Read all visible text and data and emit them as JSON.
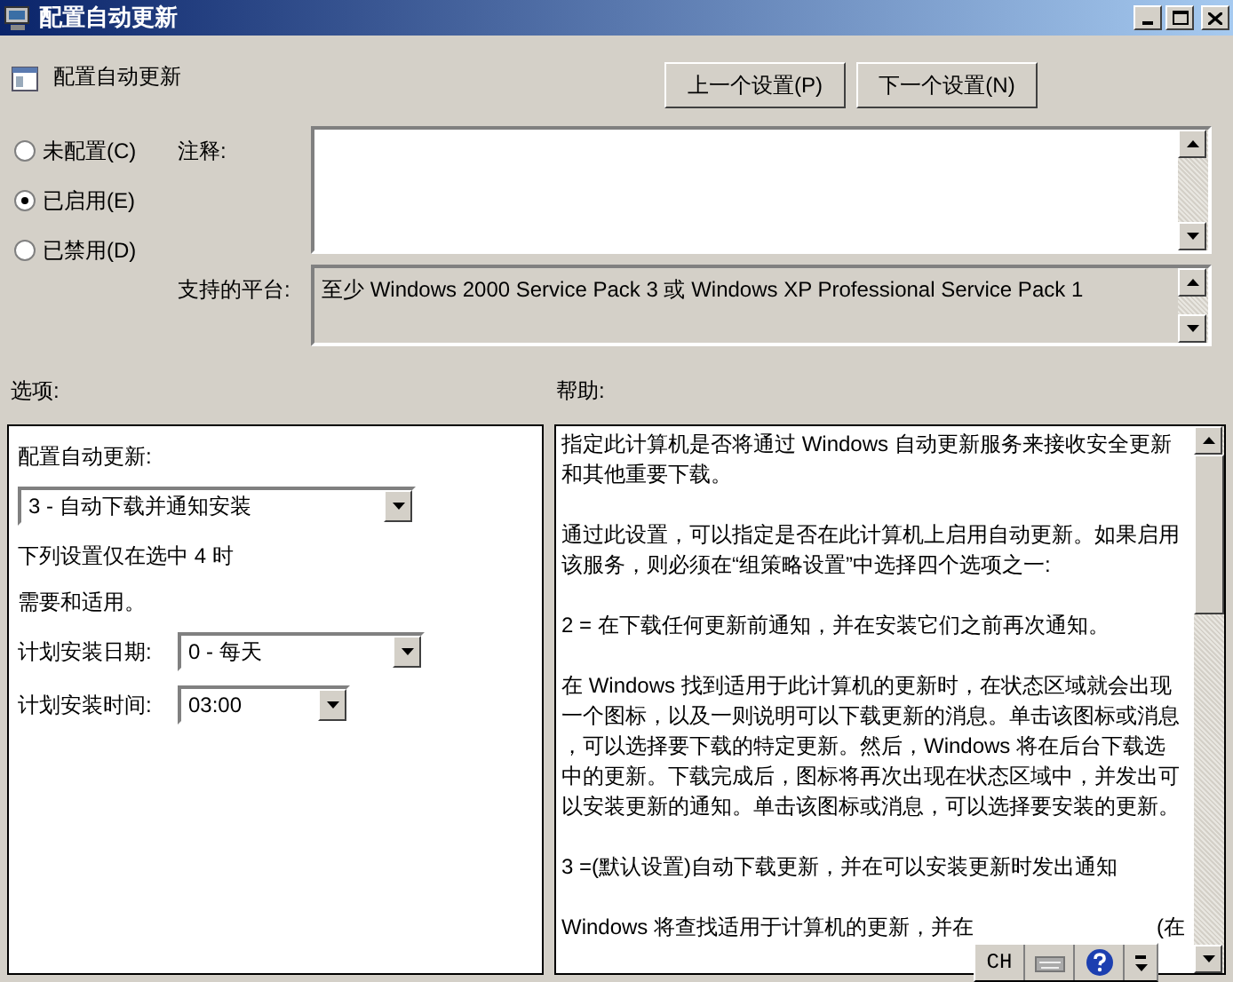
{
  "window": {
    "title": "配置自动更新"
  },
  "header": {
    "title": "配置自动更新"
  },
  "nav_buttons": [
    "上一个设置(P)",
    "下一个设置(N)"
  ],
  "state_radios": [
    {
      "label": "未配置(C)",
      "selected": false
    },
    {
      "label": "已启用(E)",
      "selected": true
    },
    {
      "label": "已禁用(D)",
      "selected": false
    }
  ],
  "comment": {
    "label": "注释:"
  },
  "platforms": {
    "label": "支持的平台:",
    "value": "至少 Windows 2000 Service Pack 3 或 Windows XP Professional Service Pack 1"
  },
  "options": {
    "label": "选项:",
    "items": [
      {
        "kind": "label",
        "text": "配置自动更新:"
      },
      {
        "kind": "select",
        "value": "3 - 自动下载并通知安装"
      },
      {
        "kind": "text",
        "text": "下列设置仅在选中 4 时"
      },
      {
        "kind": "text",
        "text": "需要和适用。"
      },
      {
        "kind": "labeled_select",
        "label": "计划安装日期:",
        "value": "0 - 每天"
      },
      {
        "kind": "labeled_select",
        "label": "计划安装时间:",
        "value": "03:00"
      }
    ]
  },
  "help": {
    "label": "帮助:",
    "paragraphs": [
      [
        "指定此计算机是否将通过 Windows 自动更新服务来接收安全更新",
        "和其他重要下载。"
      ],
      [
        "通过此设置，可以指定是否在此计算机上启用自动更新。如果启用",
        "该服务，则必须在“组策略设置”中选择四个选项之一:"
      ],
      [
        "2 = 在下载任何更新前通知，并在安装它们之前再次通知。"
      ],
      [
        "在 Windows 找到适用于此计算机的更新时，在状态区域就会出现",
        "一个图标，以及一则说明可以下载更新的消息。单击该图标或消息",
        "，可以选择要下载的特定更新。然后，Windows 将在后台下载选",
        "中的更新。下载完成后，图标将再次出现在状态区域中，并发出可",
        "以安装更新的通知。单击该图标或消息，可以选择要安装的更新。"
      ],
      [
        "3 =(默认设置)自动下载更新，并在可以安装更新时发出通知"
      ]
    ],
    "last_line": [
      "Windows 将查找适用于计算机的更新，并在",
      "(在"
    ]
  },
  "language_bar": {
    "code": "CH"
  }
}
